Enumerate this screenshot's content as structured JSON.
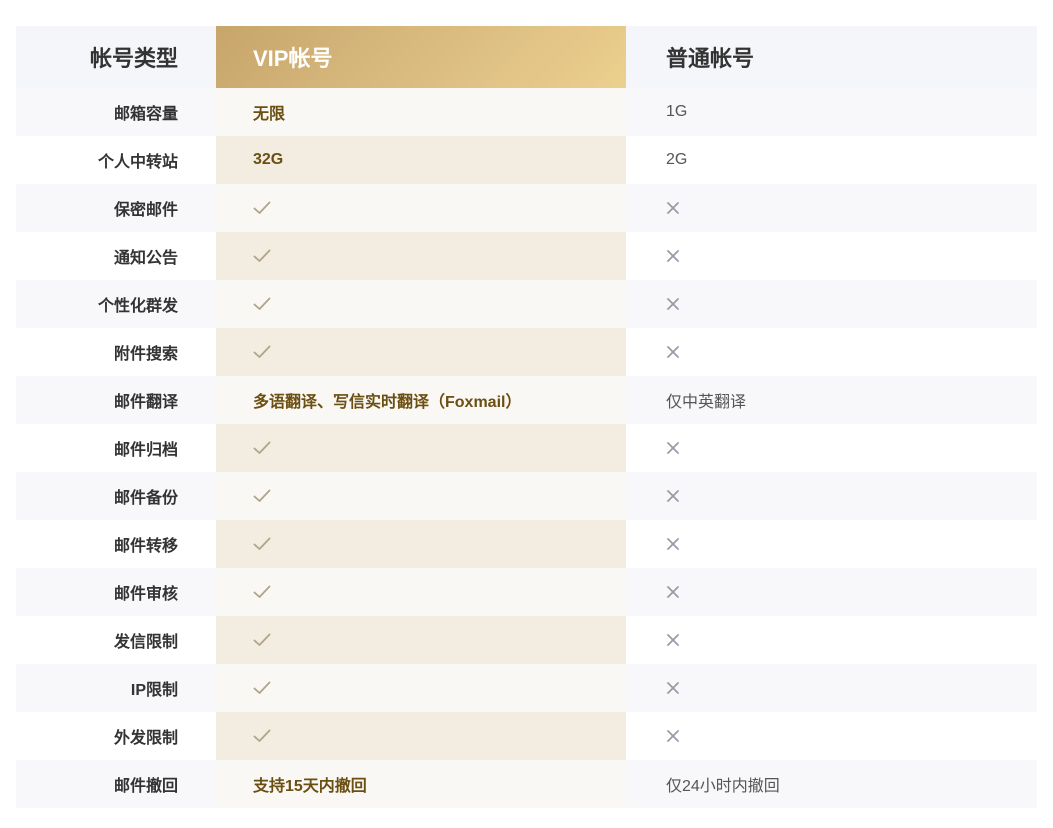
{
  "header": {
    "label": "帐号类型",
    "vip": "VIP帐号",
    "normal": "普通帐号"
  },
  "rows": [
    {
      "label": "邮箱容量",
      "vip": "无限",
      "normal": "1G"
    },
    {
      "label": "个人中转站",
      "vip": "32G",
      "normal": "2G"
    },
    {
      "label": "保密邮件",
      "vip_icon": "check-icon",
      "normal_icon": "cross-icon"
    },
    {
      "label": "通知公告",
      "vip_icon": "check-icon",
      "normal_icon": "cross-icon"
    },
    {
      "label": "个性化群发",
      "vip_icon": "check-icon",
      "normal_icon": "cross-icon"
    },
    {
      "label": "附件搜索",
      "vip_icon": "check-icon",
      "normal_icon": "cross-icon"
    },
    {
      "label": "邮件翻译",
      "vip": "多语翻译、写信实时翻译（Foxmail）",
      "normal": "仅中英翻译"
    },
    {
      "label": "邮件归档",
      "vip_icon": "check-icon",
      "normal_icon": "cross-icon"
    },
    {
      "label": "邮件备份",
      "vip_icon": "check-icon",
      "normal_icon": "cross-icon"
    },
    {
      "label": "邮件转移",
      "vip_icon": "check-icon",
      "normal_icon": "cross-icon"
    },
    {
      "label": "邮件审核",
      "vip_icon": "check-icon",
      "normal_icon": "cross-icon"
    },
    {
      "label": "发信限制",
      "vip_icon": "check-icon",
      "normal_icon": "cross-icon"
    },
    {
      "label": "IP限制",
      "vip_icon": "check-icon",
      "normal_icon": "cross-icon"
    },
    {
      "label": "外发限制",
      "vip_icon": "check-icon",
      "normal_icon": "cross-icon"
    },
    {
      "label": "邮件撤回",
      "vip": "支持15天内撤回",
      "normal": "仅24小时内撤回"
    }
  ],
  "colors": {
    "vip_accent": "#c7a56b",
    "vip_text": "#6b4f12",
    "check": "#b0a48a",
    "cross": "#9a9aa8"
  }
}
